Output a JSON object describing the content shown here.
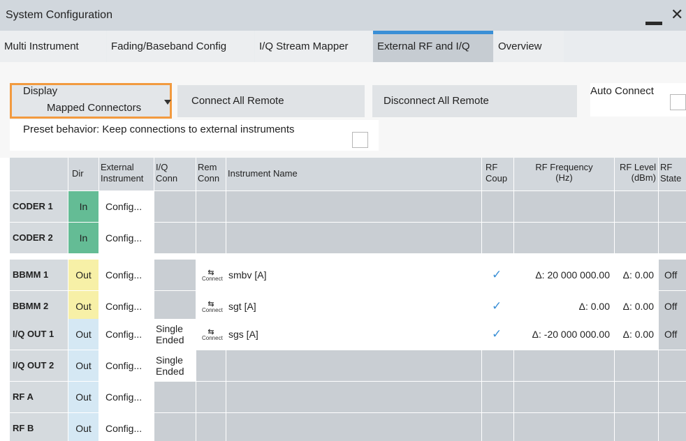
{
  "window": {
    "title": "System Configuration",
    "minimize_label": "",
    "close_label": "✕"
  },
  "tabs": [
    {
      "label": "Multi Instrument",
      "active": false
    },
    {
      "label": "Fading/Baseband Config",
      "active": false
    },
    {
      "label": "I/Q Stream Mapper",
      "active": false
    },
    {
      "label": "External RF and I/Q",
      "active": true
    },
    {
      "label": "Overview",
      "active": false
    }
  ],
  "toolbar": {
    "display_label": "Display",
    "display_value": "Mapped Connectors",
    "connect_all_remote": "Connect All Remote",
    "disconnect_all_remote": "Disconnect All Remote",
    "auto_connect_label": "Auto Connect",
    "auto_connect_checked": false,
    "preset_label": "Preset behavior: Keep connections to external instruments",
    "preset_checked": false
  },
  "colors": {
    "accent": "#3a8fd6",
    "focus_border": "#f29a3f",
    "dir_in": "#64bc95",
    "dir_out_mapped": "#f7f0a7",
    "dir_out": "#d5e8f4"
  },
  "table": {
    "headers": {
      "dir": "Dir",
      "ext_1": "External",
      "ext_2": "Instrument",
      "iq_1": "I/Q",
      "iq_2": "Conn",
      "rem_1": "Rem",
      "rem_2": "Conn",
      "name": "Instrument Name",
      "coup_1": "RF",
      "coup_2": "Coup",
      "freq_1": "RF Frequency",
      "freq_2": "(Hz)",
      "level_1": "RF Level",
      "level_2": "(dBm)",
      "state_1": "RF",
      "state_2": "State"
    },
    "rows": [
      {
        "label": "CODER 1",
        "dir": "In",
        "ext": "Config...",
        "iq1": "",
        "iq2": "",
        "rem": false,
        "name": "",
        "coup": false,
        "freq": "",
        "level": "",
        "state": ""
      },
      {
        "label": "CODER 2",
        "dir": "In",
        "ext": "Config...",
        "iq1": "",
        "iq2": "",
        "rem": false,
        "name": "",
        "coup": false,
        "freq": "",
        "level": "",
        "state": ""
      },
      {
        "label": "BBMM 1",
        "dir": "Out",
        "ext": "Config...",
        "iq1": "",
        "iq2": "",
        "rem": true,
        "name": "smbv [A]",
        "coup": true,
        "freq": "Δ: 20 000 000.00",
        "level": "Δ: 0.00",
        "state": "Off"
      },
      {
        "label": "BBMM 2",
        "dir": "Out",
        "ext": "Config...",
        "iq1": "",
        "iq2": "",
        "rem": true,
        "name": "sgt [A]",
        "coup": true,
        "freq": "Δ: 0.00",
        "level": "Δ: 0.00",
        "state": "Off"
      },
      {
        "label": "I/Q OUT 1",
        "dir": "Out",
        "ext": "Config...",
        "iq1": "Single",
        "iq2": "Ended",
        "rem": true,
        "name": "sgs [A]",
        "coup": true,
        "freq": "Δ: -20 000 000.00",
        "level": "Δ: 0.00",
        "state": "Off"
      },
      {
        "label": "I/Q OUT 2",
        "dir": "Out",
        "ext": "Config...",
        "iq1": "Single",
        "iq2": "Ended",
        "rem": false,
        "name": "",
        "coup": false,
        "freq": "",
        "level": "",
        "state": ""
      },
      {
        "label": "RF A",
        "dir": "Out",
        "ext": "Config...",
        "iq1": "",
        "iq2": "",
        "rem": false,
        "name": "",
        "coup": false,
        "freq": "",
        "level": "",
        "state": ""
      },
      {
        "label": "RF B",
        "dir": "Out",
        "ext": "Config...",
        "iq1": "",
        "iq2": "",
        "rem": false,
        "name": "",
        "coup": false,
        "freq": "",
        "level": "",
        "state": ""
      }
    ],
    "connect_icon_label": "Connect"
  }
}
